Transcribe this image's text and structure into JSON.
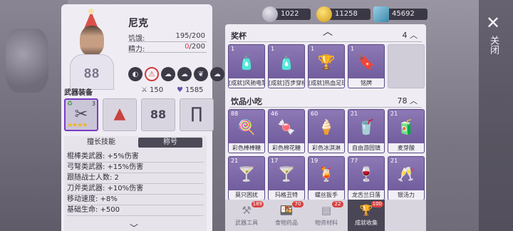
{
  "resources": [
    {
      "icon": "silver-coin-icon",
      "value": "1022"
    },
    {
      "icon": "gold-coin-icon",
      "value": "11258"
    },
    {
      "icon": "ticket-icon",
      "value": "45692"
    }
  ],
  "character": {
    "name": "尼克",
    "hunger_label": "饥饿:",
    "hunger_value": "195/200",
    "energy_label": "精力:",
    "energy_current": "0",
    "energy_max": "/200",
    "jersey_number": "88",
    "status_icons": [
      "stomach-icon",
      "alert-person-icon",
      "sheep-icon",
      "sheep-icon",
      "leaf-icon",
      "sheep-icon"
    ],
    "equipment_title": "武器装备",
    "attack": "150",
    "health": "1585",
    "slots": [
      {
        "name": "weapon-slot",
        "glyph": "✂",
        "stars": "★★★★",
        "level": "3"
      },
      {
        "name": "hat-slot",
        "glyph": "▲"
      },
      {
        "name": "jersey-slot",
        "glyph": "88"
      },
      {
        "name": "pants-slot",
        "glyph": "∏"
      }
    ],
    "skill_tab_1": "擅长技能",
    "skill_tab_2": "称号",
    "skills": [
      "棍棒类武器: +5%伤害",
      "弓弩类武器: +15%伤害",
      "跟随战士人数: 2",
      "刀斧类武器: +10%伤害",
      "移动速度: +8%",
      "基础生命: +500"
    ]
  },
  "sections": {
    "trophies": {
      "title": "奖杯",
      "count": "4",
      "items": [
        {
          "qty": "1",
          "name": "[成就]风驰电掣",
          "icon": "bottle-icon",
          "glyph": "🧴"
        },
        {
          "qty": "1",
          "name": "[成就]百步穿杨",
          "icon": "bottle-icon",
          "glyph": "🧴"
        },
        {
          "qty": "1",
          "name": "[成就]热血足球",
          "icon": "trophy-icon",
          "glyph": "🏆"
        },
        {
          "qty": "1",
          "name": "铭牌",
          "icon": "nameplate-icon",
          "glyph": "🔖"
        },
        {
          "qty": "",
          "name": "",
          "icon": "empty-slot",
          "glyph": ""
        }
      ]
    },
    "drinks": {
      "title": "饮品小吃",
      "count": "78",
      "items": [
        {
          "qty": "88",
          "name": "彩色棒棒糖",
          "icon": "lollipop-icon",
          "glyph": "🍭"
        },
        {
          "qty": "46",
          "name": "彩色棉花糖",
          "icon": "cotton-candy-icon",
          "glyph": "🍬"
        },
        {
          "qty": "60",
          "name": "彩色冰淇淋",
          "icon": "ice-cream-icon",
          "glyph": "🍦"
        },
        {
          "qty": "21",
          "name": "自由游园镇",
          "icon": "drink-icon",
          "glyph": "🥤"
        },
        {
          "qty": "21",
          "name": "麦芽酸",
          "icon": "juice-icon",
          "glyph": "🧃"
        },
        {
          "qty": "21",
          "name": "莫只困扰",
          "icon": "mojito-icon",
          "glyph": "🍸"
        },
        {
          "qty": "17",
          "name": "玛格丑特",
          "icon": "margarita-icon",
          "glyph": "🍸"
        },
        {
          "qty": "19",
          "name": "螺丝扳手",
          "icon": "screwdriver-drink-icon",
          "glyph": "🍹"
        },
        {
          "qty": "77",
          "name": "龙舌兰日落",
          "icon": "cocktail-icon",
          "glyph": "🍷"
        },
        {
          "qty": "21",
          "name": "银汤力",
          "icon": "tonic-icon",
          "glyph": "🥂"
        }
      ]
    }
  },
  "category_tabs": [
    {
      "label": "武器工具",
      "badge": "189",
      "icon": "tools-icon",
      "glyph": "⚒"
    },
    {
      "label": "食物药品",
      "badge": "70",
      "icon": "food-icon",
      "glyph": "🍱"
    },
    {
      "label": "物资材料",
      "badge": "22",
      "icon": "materials-icon",
      "glyph": "▤"
    },
    {
      "label": "成就收集",
      "badge": "100",
      "icon": "trophy-icon",
      "glyph": "🏆"
    },
    {
      "label": "",
      "badge": "",
      "icon": "",
      "glyph": ""
    }
  ],
  "close": {
    "label": "关闭",
    "glyph": "✕"
  }
}
